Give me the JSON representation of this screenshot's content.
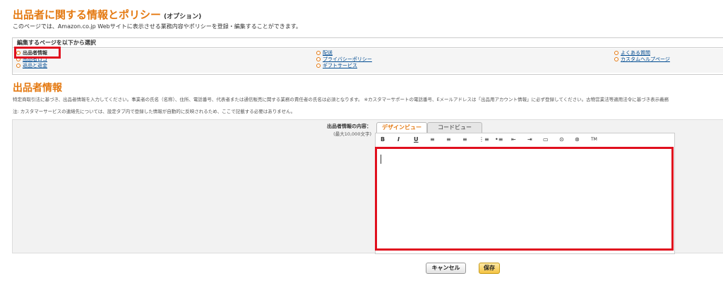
{
  "header": {
    "title": "出品者に関する情報とポリシー",
    "title_suffix": "(オプション)",
    "intro": "このページでは、Amazon.co.jp Webサイトに表示させる業務内容やポリシーを登録・編集することができます。"
  },
  "selector": {
    "heading": "編集するページを以下から選択",
    "col1": [
      "出品者情報",
      "出品者ロゴ",
      "返品と返金"
    ],
    "col2": [
      "配送",
      "プライバシーポリシー",
      "ギフトサービス"
    ],
    "col3": [
      "よくある質問",
      "カスタムヘルプページ"
    ]
  },
  "section": {
    "title": "出品者情報",
    "note1": "特定商取引法に基づき、出品者情報を入力してください。事業者の氏名（名称）、住所、電話番号、代表者または通信販売に関する業務の責任者の氏名は必須となります。 ※カスタマーサポートの電話番号、Eメールアドレスは「出品用アカウント情報」に必ず登録してください。古物営業法等適用法令に基づき表示義務",
    "note2": "注: カスタマーサービスの連絡先については、設定タブ内で登録した情報が自動的に反映されるため、ここで記載する必要はありません。"
  },
  "form": {
    "label": "出品者情報の内容：",
    "sublabel": "(最大10,000文字)",
    "tabs": [
      "デザインビュー",
      "コードビュー"
    ],
    "toolbar": [
      "B",
      "I",
      "U",
      "≡",
      "≡",
      "≡",
      "⋮≡",
      "•≡",
      "⇤",
      "⇥",
      "▭",
      "⊙",
      "⊛",
      "TM"
    ],
    "content": ""
  },
  "buttons": {
    "cancel": "キャンセル",
    "save": "保存"
  }
}
